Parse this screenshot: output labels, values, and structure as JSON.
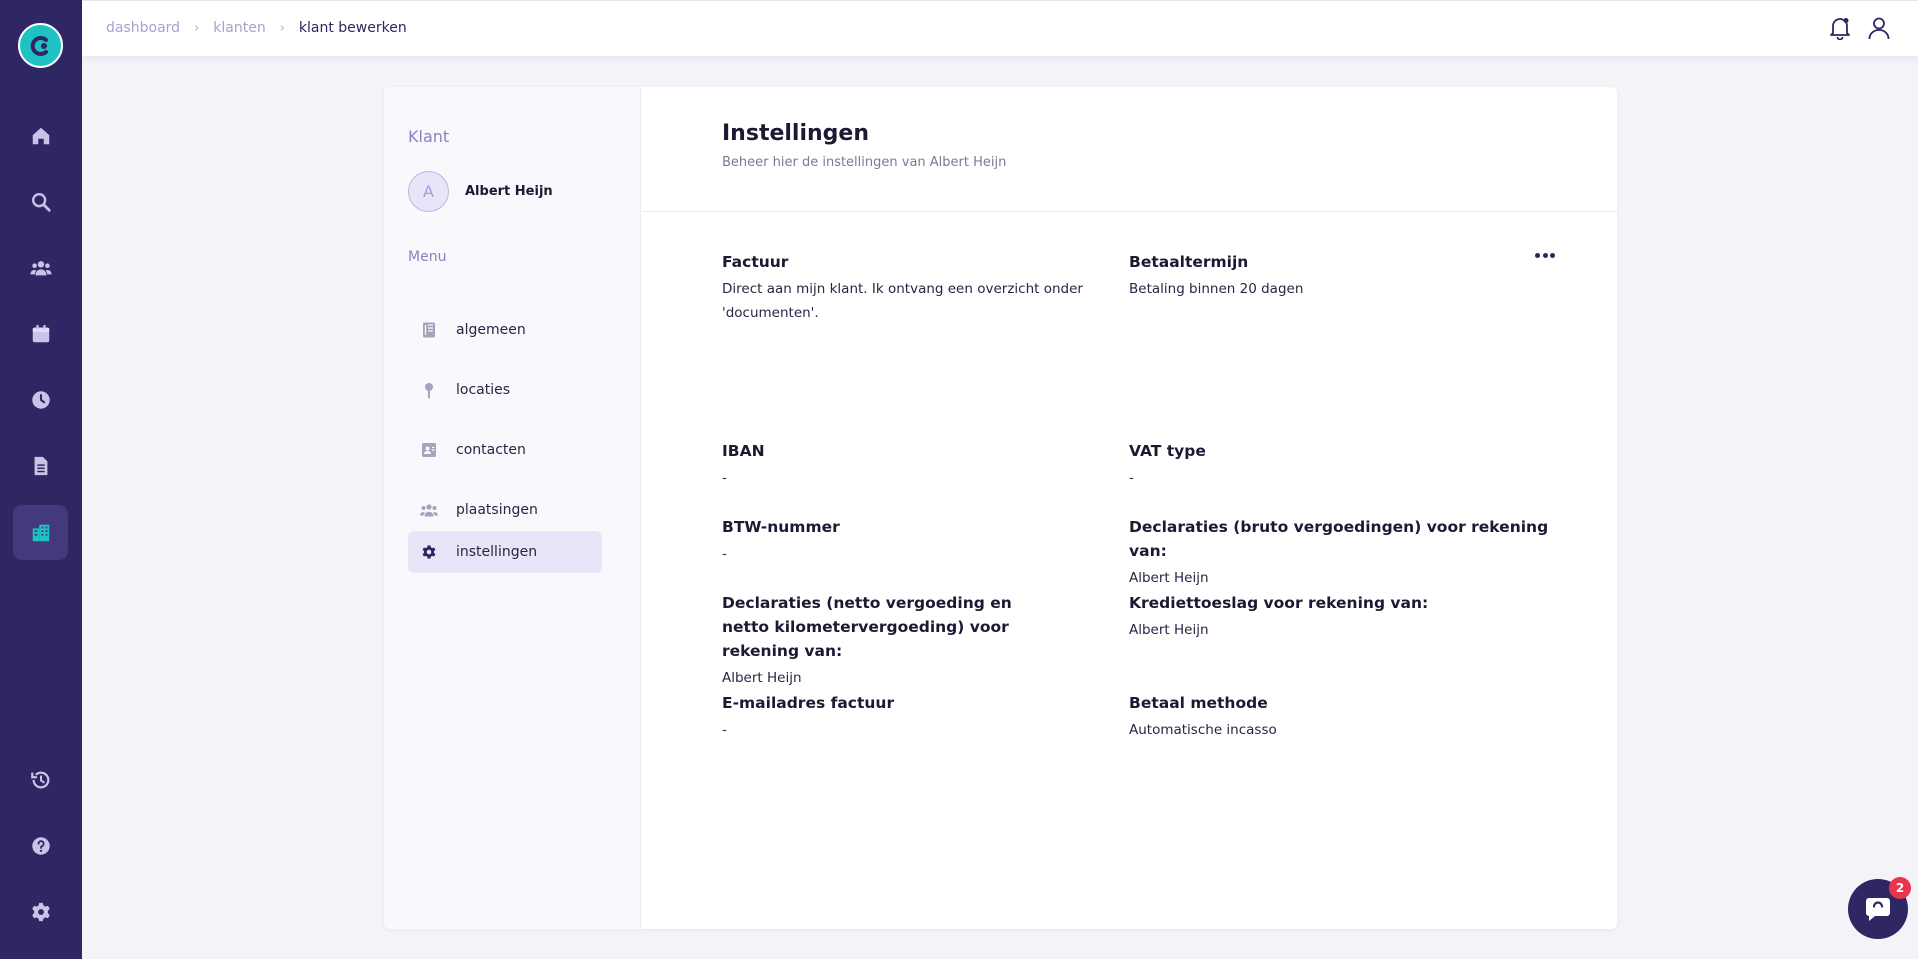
{
  "breadcrumb": {
    "items": [
      "dashboard",
      "klanten"
    ],
    "current": "klant bewerken",
    "separator": "›"
  },
  "sidebar_nav": {
    "icons": [
      "home-icon",
      "search-icon",
      "users-icon",
      "calendar-icon",
      "clock-icon",
      "document-icon",
      "buildings-icon",
      "history-icon",
      "help-icon",
      "settings-icon"
    ],
    "active": "buildings-icon"
  },
  "client_panel": {
    "title": "Klant",
    "avatar_letter": "A",
    "client_name": "Albert Heijn",
    "menu_title": "Menu",
    "menu": [
      {
        "label": "algemeen",
        "icon": "book-icon"
      },
      {
        "label": "locaties",
        "icon": "pin-icon"
      },
      {
        "label": "contacten",
        "icon": "contact-card-icon"
      },
      {
        "label": "plaatsingen",
        "icon": "group-icon"
      },
      {
        "label": "instellingen",
        "icon": "gear-icon",
        "active": true
      }
    ]
  },
  "settings": {
    "title": "Instellingen",
    "subtitle": "Beheer hier de instellingen van Albert Heijn",
    "fields": {
      "factuur": {
        "label": "Factuur",
        "value": "Direct aan mijn klant. Ik ontvang een overzicht onder 'documenten'."
      },
      "betaaltermijn": {
        "label": "Betaaltermijn",
        "value": "Betaling binnen 20 dagen"
      },
      "iban": {
        "label": "IBAN",
        "value": "-"
      },
      "vat_type": {
        "label": "VAT type",
        "value": "-"
      },
      "btw_nummer": {
        "label": "BTW-nummer",
        "value": "-"
      },
      "declaraties_bruto": {
        "label": "Declaraties (bruto vergoedingen) voor rekening van:",
        "value": "Albert Heijn"
      },
      "declaraties_netto": {
        "label": "Declaraties (netto vergoeding en netto kilometervergoeding) voor rekening van:",
        "value": "Albert Heijn"
      },
      "kredietoeslag": {
        "label": "Krediettoeslag voor rekening van:",
        "value": "Albert Heijn"
      },
      "email_factuur": {
        "label": "E-mailadres factuur",
        "value": "-"
      },
      "betaal_methode": {
        "label": "Betaal methode",
        "value": "Automatische incasso"
      }
    }
  },
  "chat": {
    "badge_count": "2"
  },
  "colors": {
    "rail": "#2f2764",
    "accent": "#1fc2c2",
    "active_menu": "#e9e5f8",
    "badge": "#e8344f"
  }
}
